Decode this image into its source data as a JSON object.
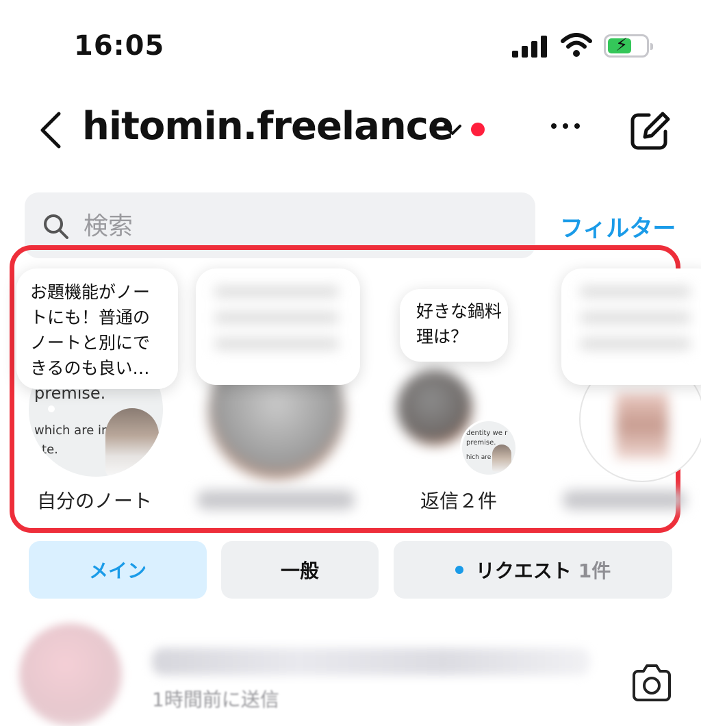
{
  "status_bar": {
    "time": "16:05"
  },
  "header": {
    "username": "hitomin.freelance"
  },
  "search": {
    "placeholder": "検索",
    "filter_label": "フィルター"
  },
  "notes": [
    {
      "bubble": "お題機能がノートにも！普通のノートと別にできるのも良い…",
      "label": "自分のノート"
    },
    {
      "bubble": "",
      "label": ""
    },
    {
      "bubble": "好きな鍋料理は？",
      "label": "返信２件"
    },
    {
      "bubble": "",
      "label": ""
    }
  ],
  "tabs": {
    "main": "メイン",
    "general": "一般",
    "requests": "リクエスト",
    "requests_count": "1件"
  },
  "chat": {
    "subtitle": "1時間前に送信"
  },
  "colors": {
    "accent": "#1a9be8",
    "highlight": "#ee2e3a",
    "active_dot": "#ff1f3d"
  }
}
